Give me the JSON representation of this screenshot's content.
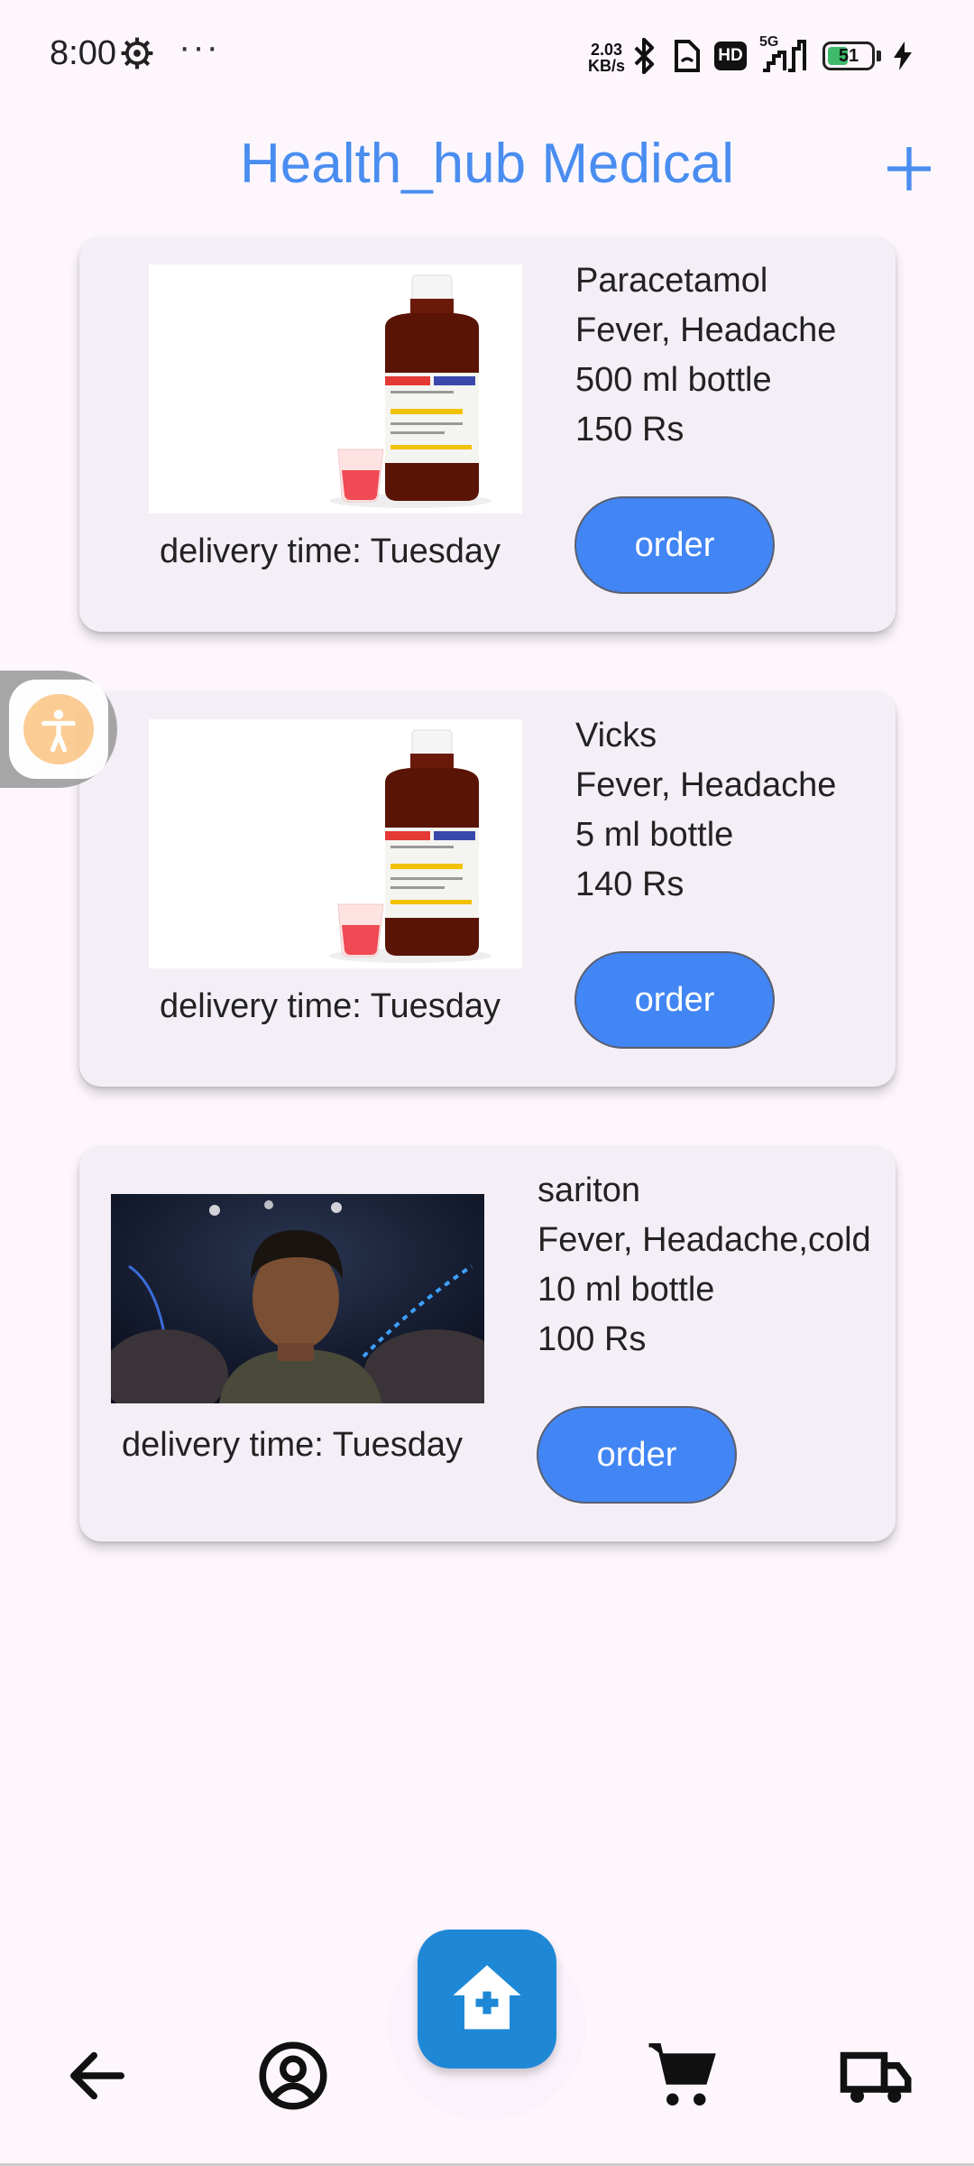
{
  "status_bar": {
    "time": "8:00",
    "more_dots": "···",
    "net_speed_value": "2.03",
    "net_speed_unit": "KB/s",
    "hd_label": "HD",
    "network_label": "5G",
    "battery_level": "51",
    "icons": [
      "gear-icon",
      "bluetooth-icon",
      "nfc-icon",
      "hd-icon",
      "signal-icon",
      "battery-icon",
      "charging-icon"
    ]
  },
  "header": {
    "title": "Health_hub Medical",
    "add_icon": "plus-icon",
    "accent_color": "#4a8df0"
  },
  "products": [
    {
      "name": "Paracetamol",
      "use": "Fever, Headache",
      "size": "500 ml bottle",
      "price": "150 Rs",
      "delivery": "delivery time: Tuesday",
      "order_label": "order",
      "image": "medicine-bottle"
    },
    {
      "name": "Vicks",
      "use": "Fever, Headache",
      "size": "5 ml bottle",
      "price": "140 Rs",
      "delivery": "delivery time: Tuesday",
      "order_label": "order",
      "image": "medicine-bottle"
    },
    {
      "name": "sariton",
      "use": "Fever, Headache,cold",
      "size": "10 ml bottle",
      "price": "100 Rs",
      "delivery": "delivery time: Tuesday",
      "order_label": "order",
      "image": "person-photo"
    }
  ],
  "bottom_nav": {
    "items": [
      "back-arrow-icon",
      "account-circle-icon",
      "home-medical-icon",
      "cart-icon",
      "delivery-truck-icon"
    ],
    "fab_color": "#1e88d6"
  },
  "colors": {
    "button": "#4285f4",
    "card": "#f4eff6",
    "background": "#fdf7fd"
  }
}
